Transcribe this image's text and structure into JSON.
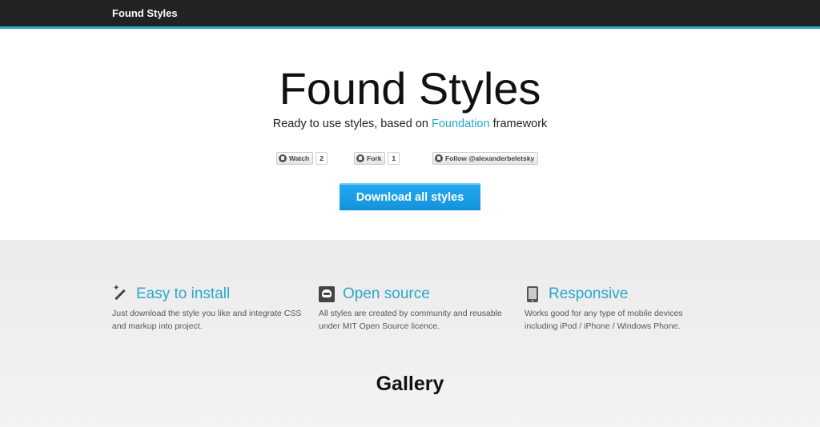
{
  "nav": {
    "brand": "Found Styles"
  },
  "hero": {
    "title": "Found Styles",
    "subtitle_before": "Ready to use styles, based on ",
    "subtitle_link": "Foundation",
    "subtitle_after": " framework",
    "github_buttons": [
      {
        "label": "Watch",
        "count": "2"
      },
      {
        "label": "Fork",
        "count": "1"
      },
      {
        "label": "Follow @alexanderbeletsky"
      }
    ],
    "download_label": "Download all styles"
  },
  "features": [
    {
      "icon": "magic-wand-icon",
      "title": "Easy to install",
      "text": "Just download the style you like and integrate CSS and markup into project."
    },
    {
      "icon": "github-octocat-icon",
      "title": "Open source",
      "text": "All styles are created by community and reusable under MIT Open Source licence."
    },
    {
      "icon": "tablet-icon",
      "title": "Responsive",
      "text": "Works good for any type of mobile devices including iPod / iPhone / Windows Phone."
    }
  ],
  "gallery": {
    "title": "Gallery"
  },
  "colors": {
    "accent": "#2ba6cb",
    "topbar": "#222222",
    "download": "#1a9ee6"
  }
}
